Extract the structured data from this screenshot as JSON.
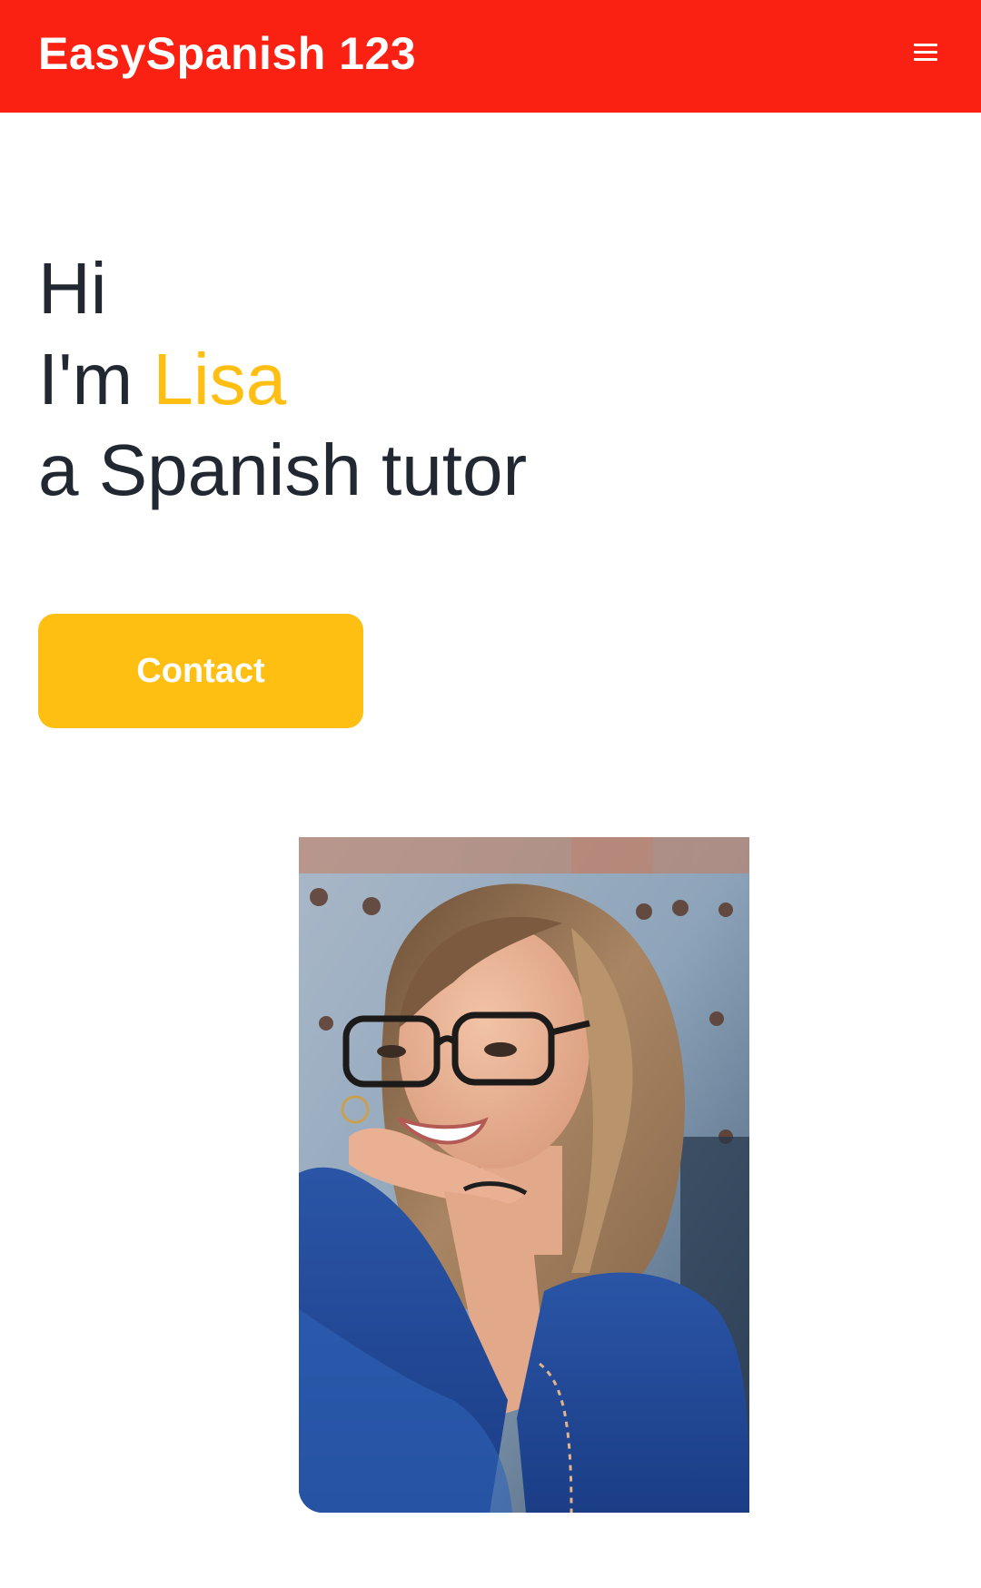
{
  "header": {
    "brand": "EasySpanish 123",
    "menu_icon": "hamburger-menu-icon",
    "background_color": "#fa2113"
  },
  "hero": {
    "greeting": "Hi",
    "intro_prefix": "I'm ",
    "name": "Lisa",
    "role": "a Spanish tutor",
    "accent_color": "#ffbf12",
    "text_color": "#222831"
  },
  "cta": {
    "contact_label": "Contact",
    "color": "#ffbf12"
  },
  "portrait": {
    "image": "tutor-portrait-photo"
  }
}
